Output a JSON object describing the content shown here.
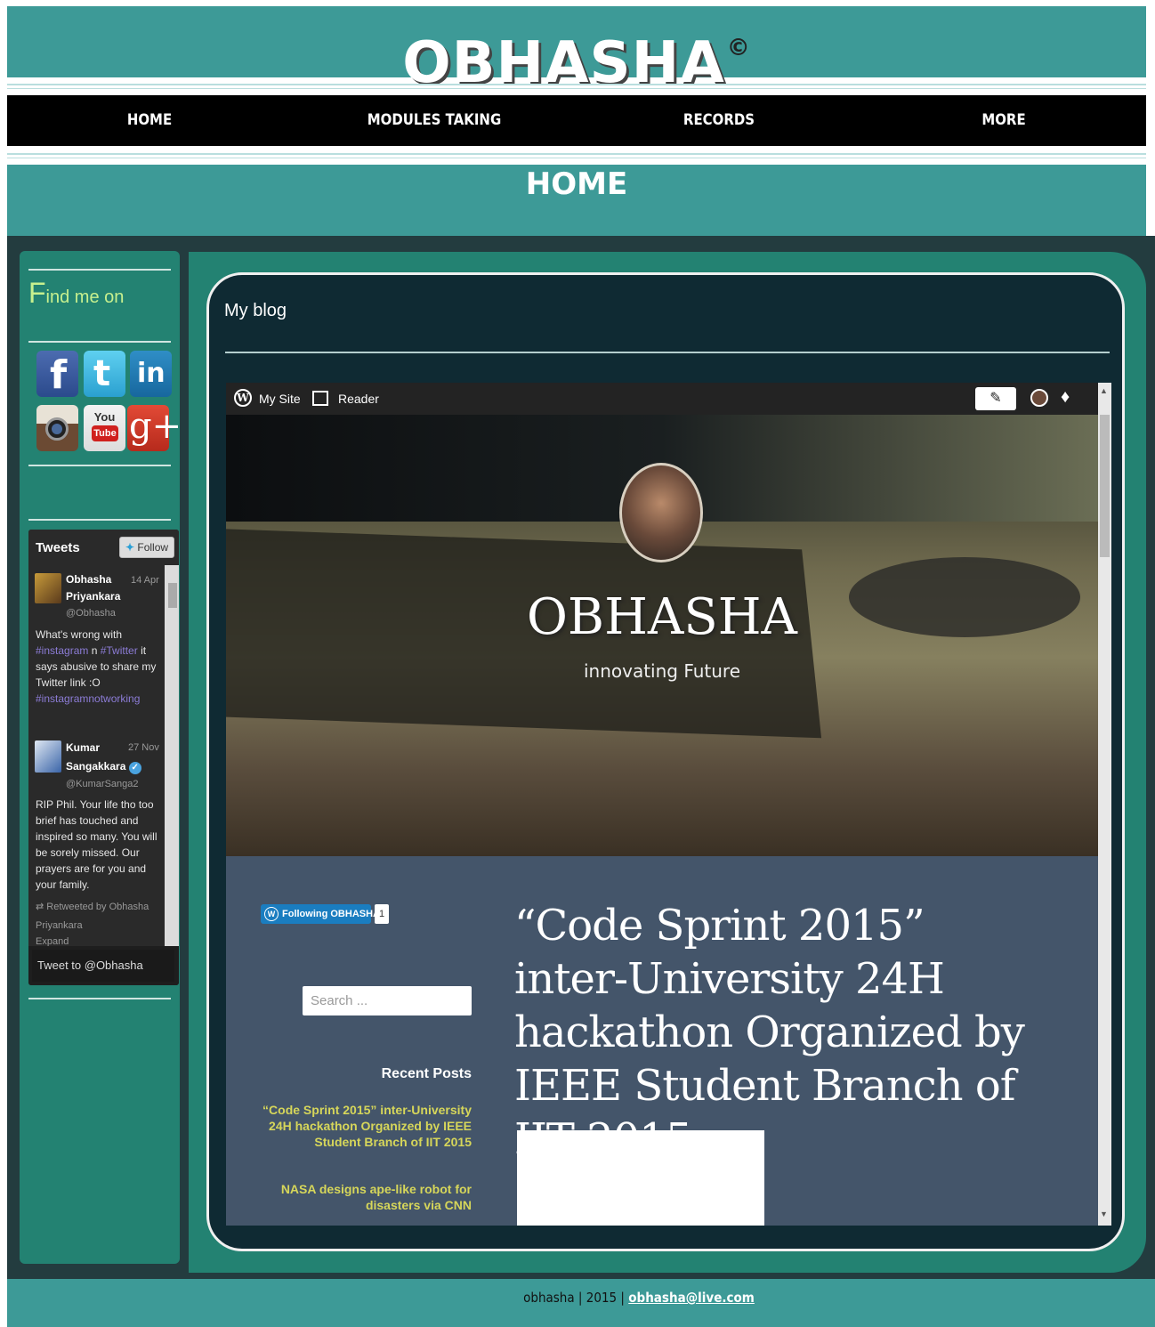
{
  "header": {
    "brand": "OBHASHA",
    "copyright": "©"
  },
  "nav": {
    "items": [
      "HOME",
      "MODULES TAKING",
      "RECORDS",
      "MORE"
    ]
  },
  "page": {
    "title": "HOME"
  },
  "sidebar": {
    "find_me_first": "F",
    "find_me_rest": "ind me on",
    "social_icons": [
      "facebook-icon",
      "twitter-icon",
      "linkedin-icon",
      "instagram-icon",
      "youtube-icon",
      "google-plus-icon"
    ],
    "youtube_you": "You",
    "youtube_tube": "Tube"
  },
  "twitter": {
    "title": "Tweets",
    "follow": "Follow",
    "tweets": [
      {
        "name_line1": "Obhasha",
        "name_line2": "Priyankara",
        "handle": "@Obhasha",
        "date": "14 Apr",
        "text_1": "What's wrong with",
        "hash_1": "#instagram",
        "text_2": " n ",
        "hash_2": "#Twitter",
        "text_3": " it says abusive to share my Twitter link :O",
        "hash_3": "#instagramnotworking"
      },
      {
        "name_line1": "Kumar",
        "name_line2": "Sangakkara",
        "handle": "@KumarSanga2",
        "date": "27 Nov",
        "text": "RIP Phil. Your life tho too brief has touched and inspired so many. You will be sorely missed. Our prayers are for you and your family.",
        "retweet": "Retweeted by Obhasha Priyankara",
        "expand": "Expand"
      }
    ],
    "compose": "Tweet to @Obhasha"
  },
  "blog": {
    "label": "My blog",
    "toolbar": {
      "my_site": "My Site",
      "reader": "Reader"
    },
    "site_title": "OBHASHA",
    "tagline": "innovating Future",
    "following_badge": "Following OBHASHA",
    "following_count": "1",
    "search_placeholder": "Search ...",
    "recent_posts_heading": "Recent Posts",
    "recent_posts": [
      "“Code Sprint 2015” inter-University 24H hackathon Organized by IEEE Student Branch of IIT 2015",
      "NASA designs ape-like robot for disasters via CNN"
    ],
    "post_title": "“Code Sprint 2015” inter-University 24H hackathon Organized by IEEE Student Branch of IIT 2015"
  },
  "footer": {
    "prefix": "obhasha | 2015 | ",
    "email": "obhasha@live.com"
  },
  "colors": {
    "teal": "#3d9a97",
    "green": "#238272",
    "dark": "#233c3f",
    "link_yellow": "#d6d65a",
    "find_me_green": "#c7f08e"
  }
}
